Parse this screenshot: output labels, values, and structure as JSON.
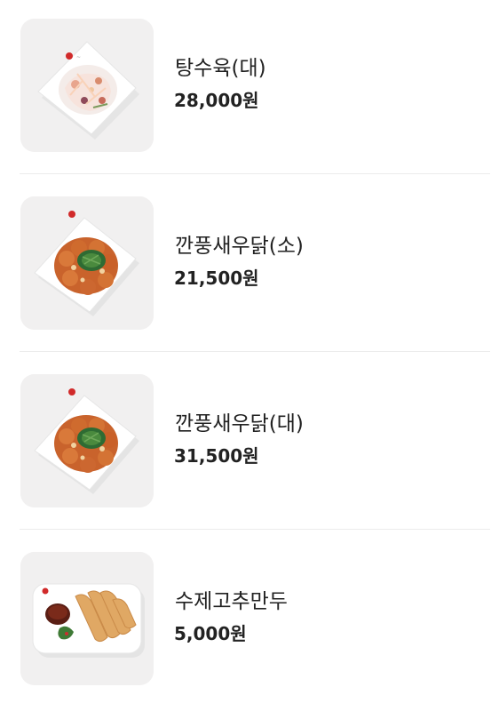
{
  "menu": {
    "items": [
      {
        "name": "탕수육(대)",
        "price": "28,000원",
        "image_icon": "salad-plate-icon"
      },
      {
        "name": "깐풍새우닭(소)",
        "price": "21,500원",
        "image_icon": "kkanpung-plate-icon"
      },
      {
        "name": "깐풍새우닭(대)",
        "price": "31,500원",
        "image_icon": "kkanpung-plate-icon"
      },
      {
        "name": "수제고추만두",
        "price": "5,000원",
        "image_icon": "dumpling-plate-icon"
      }
    ]
  }
}
